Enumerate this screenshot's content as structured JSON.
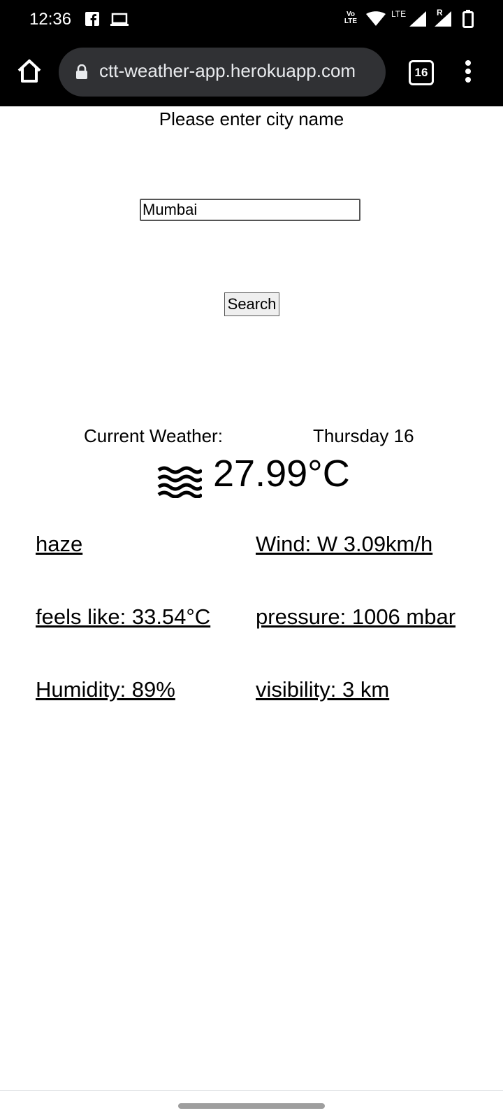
{
  "status_bar": {
    "time": "12:36",
    "icons": [
      "facebook-icon",
      "laptop-icon",
      "volte-icon",
      "wifi-icon",
      "lte-signal-icon",
      "roaming-signal-icon",
      "battery-icon"
    ],
    "volte_text": "Vo LTE",
    "lte_text": "LTE",
    "roaming_text": "R"
  },
  "browser": {
    "url": "ctt-weather-app.herokuapp.com",
    "tab_count": "16"
  },
  "form": {
    "prompt": "Please enter city name",
    "city_value": "Mumbai",
    "search_label": "Search"
  },
  "weather": {
    "current_label": "Current Weather:",
    "date": "Thursday 16",
    "icon": "haze-icon",
    "temperature": "27.99°C",
    "condition": "haze",
    "wind": "Wind: W 3.09km/h",
    "feels_like": "feels like: 33.54°C",
    "pressure": "pressure: 1006 mbar",
    "humidity": "Humidity: 89%",
    "visibility": "visibility: 3 km"
  }
}
